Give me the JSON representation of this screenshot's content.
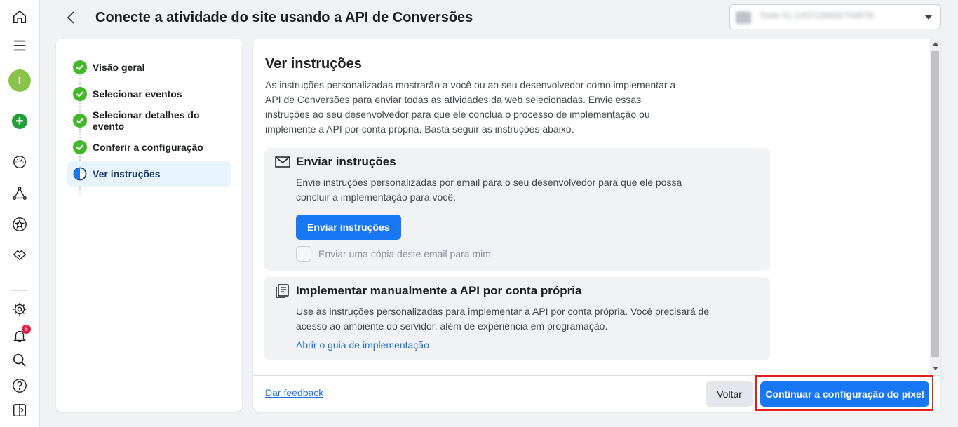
{
  "header": {
    "title": "Conecte a atividade do site usando a API de Conversões",
    "account_selector_text": "Teste 01 (1437226832703979)"
  },
  "rail": {
    "avatar_letter": "I",
    "notification_count": "6"
  },
  "steps": [
    {
      "label": "Visão geral",
      "status": "done"
    },
    {
      "label": "Selecionar eventos",
      "status": "done"
    },
    {
      "label": "Selecionar detalhes do evento",
      "status": "done"
    },
    {
      "label": "Conferir a configuração",
      "status": "done"
    },
    {
      "label": "Ver instruções",
      "status": "current"
    }
  ],
  "content": {
    "title": "Ver instruções",
    "description": "As instruções personalizadas mostrarão a você ou ao seu desenvolvedor como implementar a API de Conversões para enviar todas as atividades da web selecionadas. Envie essas instruções ao seu desenvolvedor para que ele conclua o processo de implementação ou implemente a API por conta própria. Basta seguir as instruções abaixo.",
    "send_card": {
      "title": "Enviar instruções",
      "description": "Envie instruções personalizadas por email para o seu desenvolvedor para que ele possa concluir a implementação para você.",
      "button_label": "Enviar instruções",
      "checkbox_label": "Enviar uma cópia deste email para mim"
    },
    "manual_card": {
      "title": "Implementar manualmente a API por conta própria",
      "description": "Use as instruções personalizadas para implementar a API por conta própria. Você precisará de acesso ao ambiente do servidor, além de experiência em programação.",
      "link_label": "Abrir o guia de implementação"
    }
  },
  "footer": {
    "feedback_label": "Dar feedback",
    "back_label": "Voltar",
    "continue_label": "Continuar a configuração do pixel"
  },
  "colors": {
    "primary": "#1877f2",
    "success": "#42b72a",
    "highlight_border": "#e02020"
  }
}
